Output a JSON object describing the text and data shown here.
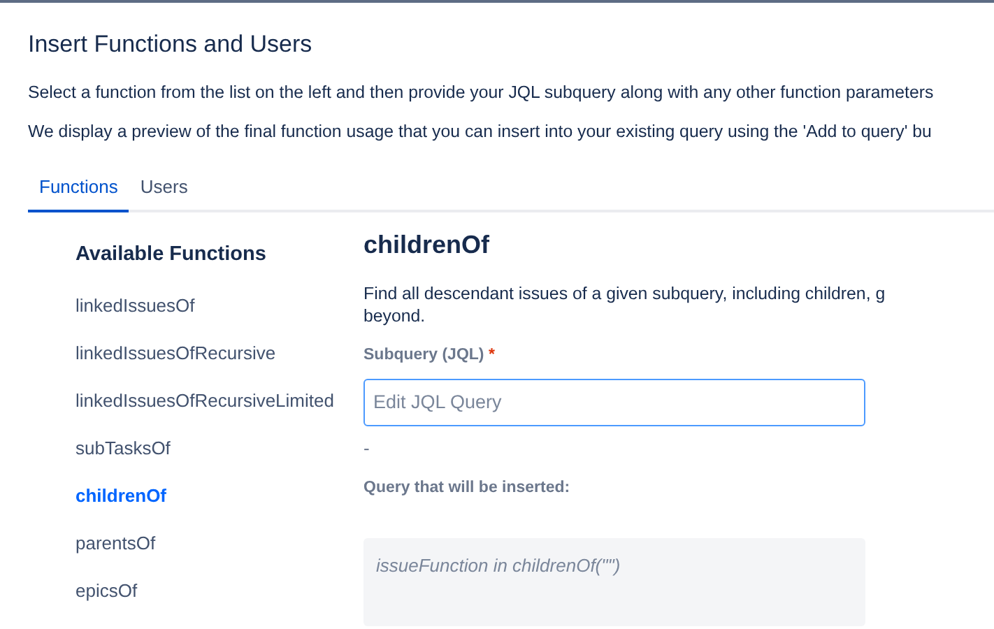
{
  "dialog": {
    "title": "Insert Functions and Users",
    "intro": [
      "Select a function from the list on the left and then provide your JQL subquery along with any other function parameters",
      "We display a preview of the final function usage that you can insert into your existing query using the 'Add to query' bu"
    ]
  },
  "tabs": [
    {
      "label": "Functions",
      "selected": true
    },
    {
      "label": "Users",
      "selected": false
    }
  ],
  "sidebar": {
    "heading": "Available Functions",
    "items": [
      {
        "label": "linkedIssuesOf",
        "selected": false
      },
      {
        "label": "linkedIssuesOfRecursive",
        "selected": false
      },
      {
        "label": "linkedIssuesOfRecursiveLimited",
        "selected": false
      },
      {
        "label": "subTasksOf",
        "selected": false
      },
      {
        "label": "childrenOf",
        "selected": true
      },
      {
        "label": "parentsOf",
        "selected": false
      },
      {
        "label": "epicsOf",
        "selected": false
      }
    ]
  },
  "detail": {
    "title": "childrenOf",
    "description": [
      "Find all descendant issues of a given subquery, including children, g",
      "beyond."
    ],
    "field": {
      "label": "Subquery (JQL)",
      "required_mark": "*",
      "placeholder": "Edit JQL Query",
      "hint": "-"
    },
    "preview_label": "Query that will be inserted:",
    "preview": "issueFunction in childrenOf(\"\")"
  }
}
